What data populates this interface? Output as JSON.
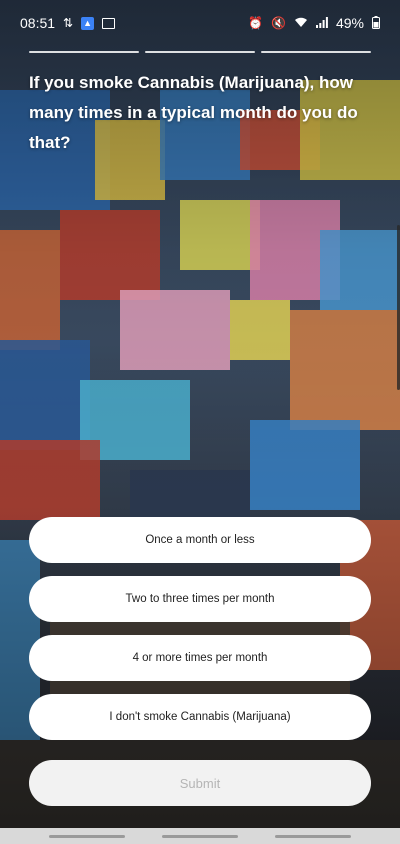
{
  "status_bar": {
    "time": "08:51",
    "battery": "49%",
    "icons_left": [
      "data-transfer-icon",
      "app-notification-icon",
      "gallery-icon"
    ],
    "icons_right": [
      "alarm-icon",
      "mute-icon",
      "wifi-icon",
      "signal-icon",
      "battery-icon"
    ]
  },
  "progress": {
    "segments": 3,
    "completed": 3
  },
  "question": {
    "text": "If you smoke Cannabis (Marijuana), how many times in a typical month do you do that?"
  },
  "answers": [
    {
      "label": "Once a month or less"
    },
    {
      "label": "Two to three times per month"
    },
    {
      "label": "4 or more times per month"
    },
    {
      "label": "I don't smoke Cannabis (Marijuana)"
    }
  ],
  "submit": {
    "label": "Submit",
    "enabled": false
  },
  "colors": {
    "button_bg": "#ffffff",
    "submit_disabled_bg": "#f2f2f2",
    "submit_disabled_text": "#b5b5b5"
  }
}
